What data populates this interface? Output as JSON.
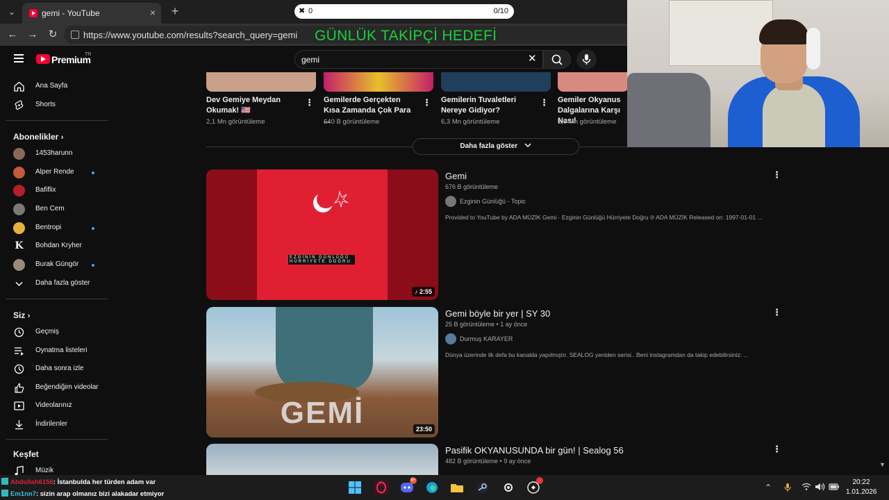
{
  "browser": {
    "tab_title": "gemi - YouTube",
    "tab_close": "×",
    "new_tab": "+",
    "url": "https://www.youtube.com/results?search_query=gemi"
  },
  "overlay": {
    "goal_icon": "✖",
    "goal_count": "0",
    "goal_total": "0/10",
    "goal_title": "GÜNLÜK TAKİPÇİ HEDEFİ"
  },
  "youtube": {
    "logo_text": "Premium",
    "logo_country": "TR",
    "search_value": "gemi",
    "search_clear": "✕",
    "sidebar": {
      "main": [
        {
          "label": "Ana Sayfa",
          "icon": "home-icon"
        },
        {
          "label": "Shorts",
          "icon": "shorts-icon"
        }
      ],
      "subscriptions_title": "Abonelikler",
      "subscriptions": [
        {
          "label": "1453harunn",
          "dot": false,
          "color": "#8a6a55"
        },
        {
          "label": "Alper Rende",
          "dot": true,
          "color": "#c45a3a"
        },
        {
          "label": "Bafiflix",
          "dot": false,
          "color": "#b3202a"
        },
        {
          "label": "Ben Cem",
          "dot": false,
          "color": "#7a7a7a"
        },
        {
          "label": "Bentropi",
          "dot": true,
          "color": "#e8b23a"
        },
        {
          "label": "Bohdan Kryher",
          "dot": false,
          "color": "#eeeeee"
        },
        {
          "label": "Burak Güngör",
          "dot": true,
          "color": "#9a8a7a"
        }
      ],
      "show_more": "Daha fazla göster",
      "you_title": "Siz",
      "you_items": [
        {
          "label": "Geçmiş",
          "icon": "history-icon"
        },
        {
          "label": "Oynatma listeleri",
          "icon": "playlists-icon"
        },
        {
          "label": "Daha sonra izle",
          "icon": "watch-later-icon"
        },
        {
          "label": "Beğendiğim videolar",
          "icon": "like-icon"
        },
        {
          "label": "Videolarınız",
          "icon": "your-videos-icon"
        },
        {
          "label": "İndirilenler",
          "icon": "downloads-icon"
        }
      ],
      "explore_title": "Keşfet",
      "explore_items": [
        {
          "label": "Müzik",
          "icon": "music-icon"
        }
      ]
    },
    "shorts": [
      {
        "title": "Dev Gemiye Meydan Okumak! 🇺🇸",
        "views": "2,1 Mn görüntüleme",
        "color": "#c9a08a"
      },
      {
        "title": "Gemilerde Gerçekten Kısa Zamanda Çok Para ...",
        "views": "640 B görüntüleme",
        "color": "#c4206a"
      },
      {
        "title": "Gemilerin Tuvaletleri Nereye Gidiyor?",
        "views": "6,3 Mn görüntüleme",
        "color": "#1f3f5a"
      },
      {
        "title": "Gemiler Okyanus Dalgalarına Karşı Nasıl",
        "views": "1,9 Mn görüntüleme",
        "color": "#d88a80"
      }
    ],
    "show_more_results": "Daha fazla göster",
    "videos": [
      {
        "title": "Gemi",
        "meta": "676 B görüntüleme",
        "channel": "Ezginin Günlüğü - Topic",
        "description": "Provided to YouTube by ADA MÜZİK Gemi · Ezginin Günlüğü Hürriyete Doğru ℗ ADA MÜZİK Released on: 1997-01-01 ...",
        "duration": "♪ 2:55",
        "thumb_text_1": "EZGİNİN GÜNLÜĞÜ",
        "thumb_text_2": "HÜRRİYETE DOĞRU"
      },
      {
        "title": "Gemi böyle bir yer | SY 30",
        "meta": "25 B görüntüleme • 1 ay önce",
        "channel": "Durmuş KARAYER",
        "description": "Dünya üzerinde ilk defa bu kanalda yapılmıştır. SEALOG yeniden serisi.. Beni instagramdan da takip edebilirsiniz: ...",
        "duration": "23:50",
        "thumb_text": "GEMİ"
      },
      {
        "title": "Pasifik OKYANUSUNDA bir gün! | Sealog 56",
        "meta": "482 B görüntüleme • 9 ay önce"
      }
    ]
  },
  "chat": [
    {
      "user": "Abdullah6156",
      "message": ": İstanbulda her türden adam var"
    },
    {
      "user": "Em1nn7",
      "message": ": sizin arap olmanız bizi alakadar etmiyor"
    }
  ],
  "taskbar": {
    "discord_badge": "9+",
    "time": "20:22",
    "date": "1.01.2026"
  }
}
